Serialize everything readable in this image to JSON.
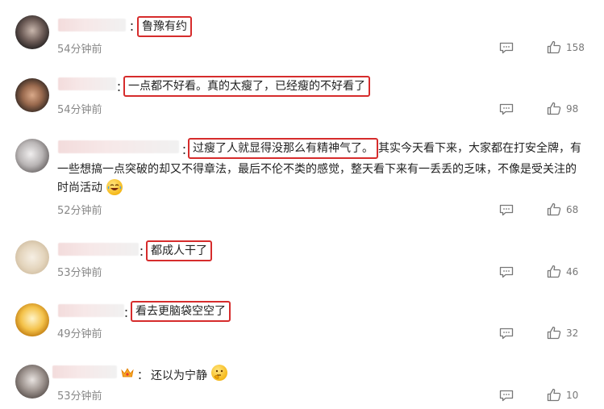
{
  "comments": [
    {
      "time": "54分钟前",
      "text": "鲁豫有约",
      "likes": "158"
    },
    {
      "time": "54分钟前",
      "text": "一点都不好看。真的太瘦了，已经瘦的不好看了",
      "likes": "98"
    },
    {
      "time": "52分钟前",
      "highlight": "过瘦了人就显得没那么有精神气了。",
      "line1_rest": "其实今天看下来，大家都在打安全牌，有",
      "line2": "一些想搞一点突破的却又不得章法，最后不伦不类的感觉，整天看下来有一丢丢的乏味，不像是受关注的",
      "line3": "时尚活动",
      "emoji": "laughing-emoji",
      "likes": "68"
    },
    {
      "time": "53分钟前",
      "text": "都成人干了",
      "likes": "46"
    },
    {
      "time": "49分钟前",
      "text": "看去更脑袋空空了",
      "likes": "32"
    },
    {
      "time": "53分钟前",
      "text": "还以为宁静",
      "emoji": "thinking-emoji",
      "badge": "crown-badge-icon",
      "likes": "10"
    }
  ],
  "colon": "：",
  "colors": {
    "highlight_border": "#d62c2c",
    "meta_text": "#888888"
  }
}
